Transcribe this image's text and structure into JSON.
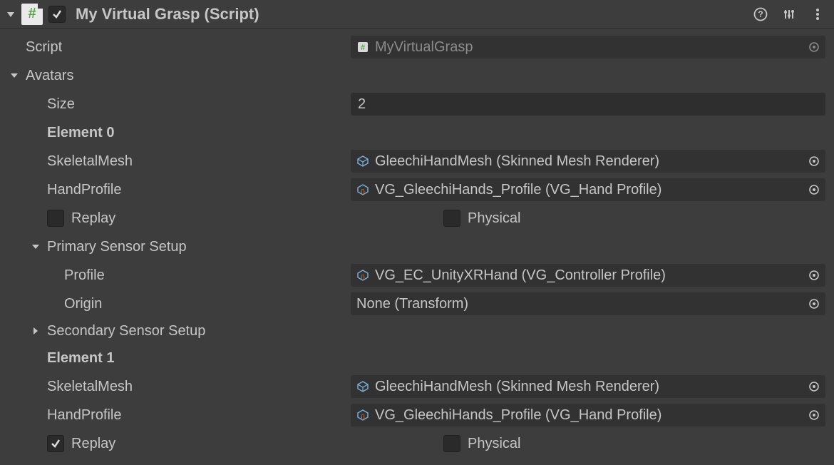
{
  "header": {
    "title": "My Virtual Grasp (Script)",
    "enabled": true
  },
  "script": {
    "label": "Script",
    "value": "MyVirtualGrasp"
  },
  "avatars": {
    "label": "Avatars",
    "size_label": "Size",
    "size_value": "2",
    "elements": [
      {
        "header": "Element 0",
        "skeletal_label": "SkeletalMesh",
        "skeletal_value": "GleechiHandMesh (Skinned Mesh Renderer)",
        "handprofile_label": "HandProfile",
        "handprofile_value": "VG_GleechiHands_Profile (VG_Hand Profile)",
        "replay_label": "Replay",
        "replay_checked": false,
        "physical_label": "Physical",
        "physical_checked": false,
        "primary": {
          "label": "Primary Sensor Setup",
          "profile_label": "Profile",
          "profile_value": "VG_EC_UnityXRHand (VG_Controller Profile)",
          "origin_label": "Origin",
          "origin_value": "None (Transform)"
        },
        "secondary": {
          "label": "Secondary Sensor Setup"
        }
      },
      {
        "header": "Element 1",
        "skeletal_label": "SkeletalMesh",
        "skeletal_value": "GleechiHandMesh (Skinned Mesh Renderer)",
        "handprofile_label": "HandProfile",
        "handprofile_value": "VG_GleechiHands_Profile (VG_Hand Profile)",
        "replay_label": "Replay",
        "replay_checked": true,
        "physical_label": "Physical",
        "physical_checked": false
      }
    ]
  }
}
